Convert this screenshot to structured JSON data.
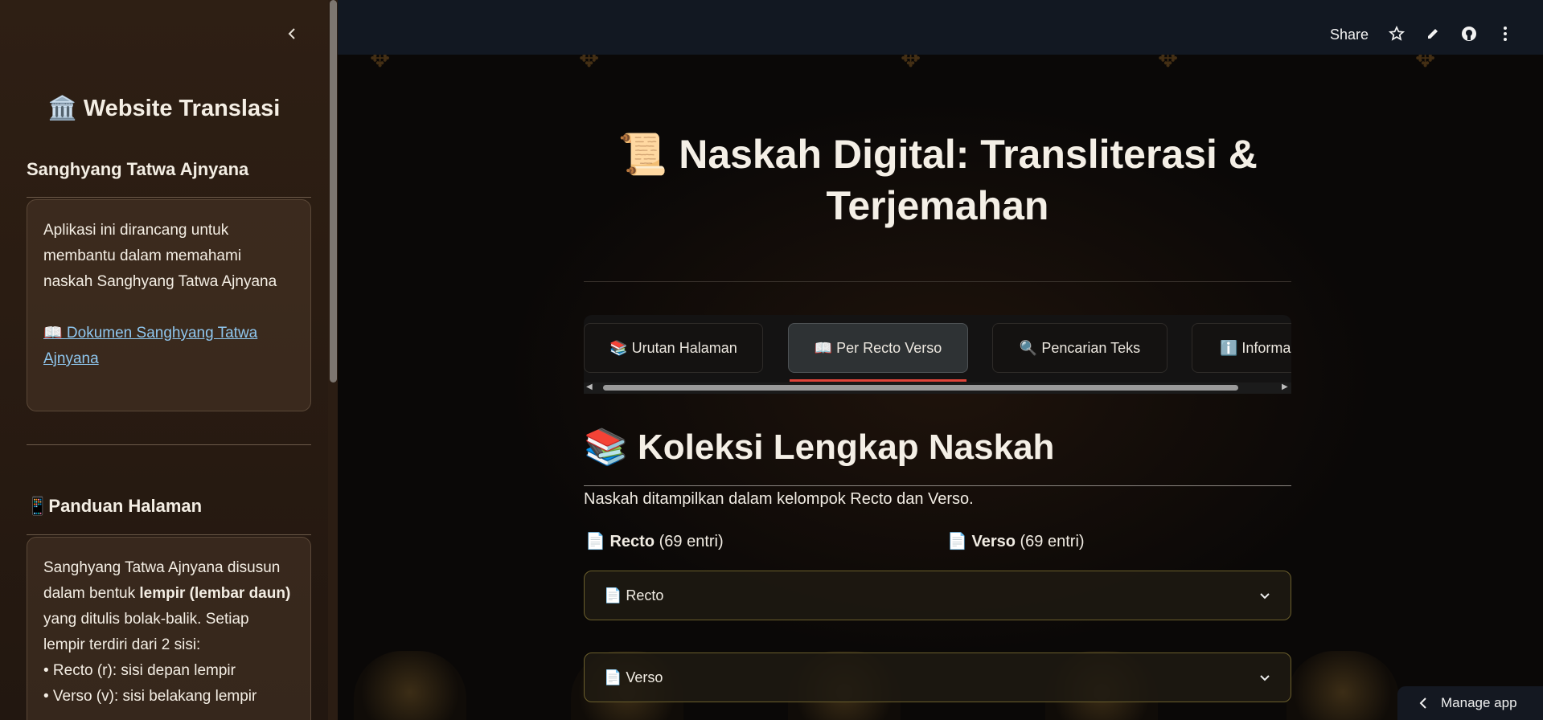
{
  "sidebar": {
    "title": "🏛️ Website Translasi",
    "section1_heading": "Sanghyang Tatwa Ajnyana",
    "intro_text": "Aplikasi ini dirancang untuk membantu dalam memahami naskah Sanghyang Tatwa Ajnyana",
    "doc_link": "📖 Dokumen Sanghyang Tatwa Ajnyana",
    "section2_heading": "📱Panduan Halaman",
    "guide": {
      "line1": "Sanghyang Tatwa Ajnyana disusun dalam bentuk ",
      "bold": "lempir (lembar daun)",
      "line2": " yang ditulis bolak-balik. Setiap lempir terdiri dari 2 sisi:",
      "bullet1": "• Recto (r): sisi depan lempir",
      "bullet2": "• Verso (v): sisi belakang lempir"
    }
  },
  "topbar": {
    "share_label": "Share"
  },
  "main": {
    "title": "📜 Naskah Digital: Transliterasi & Terjemahan",
    "tabs": [
      {
        "label": "📚 Urutan Halaman"
      },
      {
        "label": "📖 Per Recto Verso"
      },
      {
        "label": "🔍 Pencarian Teks"
      },
      {
        "label": "ℹ️ Informasi"
      }
    ],
    "section_heading": "📚 Koleksi Lengkap Naskah",
    "section_desc": "Naskah ditampilkan dalam kelompok Recto dan Verso.",
    "recto_summary": {
      "label": "Recto",
      "count": "(69 entri)"
    },
    "verso_summary": {
      "label": "Verso",
      "count": "(69 entri)"
    },
    "expanders": [
      {
        "label": "📄 Recto"
      },
      {
        "label": "📄 Verso"
      }
    ]
  },
  "manage_app": "Manage app",
  "colors": {
    "accent": "#e0443a",
    "link": "#8fc7ef",
    "expander_border": "#6b5f2c"
  }
}
